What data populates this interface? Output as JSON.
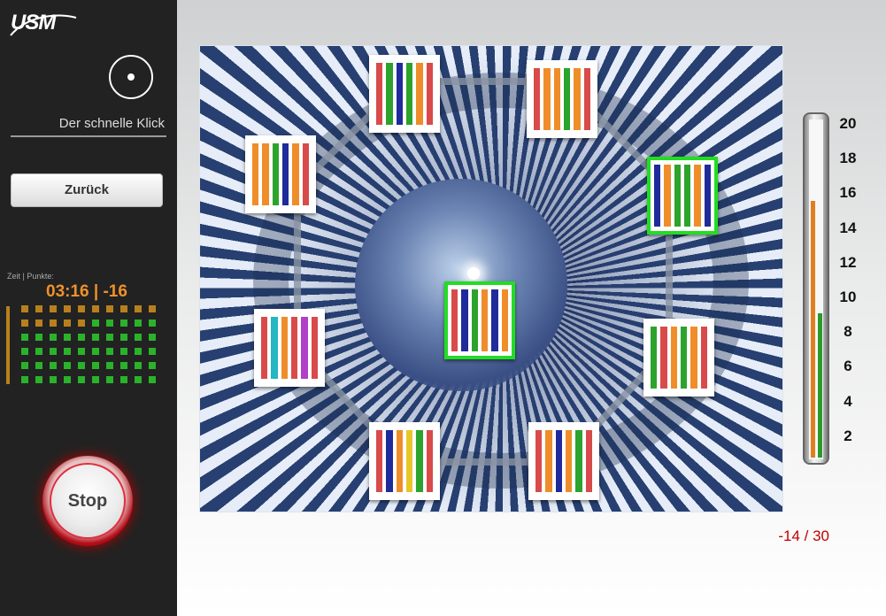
{
  "sidebar": {
    "logo": "USM",
    "target_icon": "target-dot-icon",
    "exercise_title": "Der schnelle Klick",
    "back_label": "Zurück",
    "stats_label": "Zeit | Punkte:",
    "stats_value": "03:16 | -16",
    "stop_label": "Stop",
    "dot_colors": {
      "filled": "#2bb22b",
      "empty": "#b8801c"
    }
  },
  "game": {
    "stripe_colors": {
      "red": "#d94a4a",
      "orange": "#ef8d2b",
      "green": "#2ca32c",
      "blue": "#1f2b9a",
      "yellow": "#e7c62a",
      "purple": "#b040c8",
      "teal": "#22b7c2"
    },
    "cards": [
      {
        "id": "top-left",
        "selected": false,
        "stripes": [
          "red",
          "green",
          "blue",
          "green",
          "orange",
          "red"
        ]
      },
      {
        "id": "top-right",
        "selected": false,
        "stripes": [
          "red",
          "orange",
          "orange",
          "green",
          "orange",
          "red"
        ]
      },
      {
        "id": "upper-left",
        "selected": false,
        "stripes": [
          "orange",
          "orange",
          "green",
          "blue",
          "orange",
          "red"
        ]
      },
      {
        "id": "upper-right",
        "selected": true,
        "stripes": [
          "blue",
          "orange",
          "green",
          "green",
          "orange",
          "blue"
        ]
      },
      {
        "id": "center",
        "selected": true,
        "stripes": [
          "red",
          "blue",
          "green",
          "orange",
          "blue",
          "orange"
        ]
      },
      {
        "id": "lower-left",
        "selected": false,
        "stripes": [
          "red",
          "teal",
          "orange",
          "red",
          "purple",
          "red"
        ]
      },
      {
        "id": "lower-right",
        "selected": false,
        "stripes": [
          "green",
          "red",
          "orange",
          "green",
          "orange",
          "red"
        ]
      },
      {
        "id": "bottom-left",
        "selected": false,
        "stripes": [
          "red",
          "blue",
          "orange",
          "yellow",
          "green",
          "red"
        ]
      },
      {
        "id": "bottom-right",
        "selected": false,
        "stripes": [
          "red",
          "orange",
          "blue",
          "orange",
          "green",
          "red"
        ]
      }
    ]
  },
  "gauge": {
    "labels": [
      "20",
      "18",
      "16",
      "14",
      "12",
      "10",
      "8",
      "6",
      "4",
      "2"
    ],
    "orange_level": 16,
    "green_level": 9,
    "orange_color": "#e07f1f",
    "green_color": "#2a9a2a"
  },
  "score": "-14 / 30"
}
